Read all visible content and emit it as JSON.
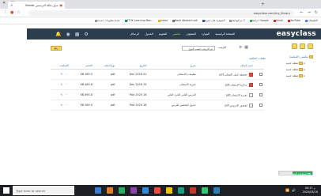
{
  "browser": {
    "tab_title": "سول ملکة الترسيس Seedle",
    "tab_close": "×",
    "new_tab": "+",
    "url": "easyclass.com/my_library",
    "bookmarks": [
      "التطبيقات",
      "YouTube",
      "Gmail",
      "خرائط Google",
      "مراجع لغة C",
      "الجوهرة على مدونة",
      "Book Abstract pdf",
      "index",
      "FTUK Learning Man...",
      "تغذية معلومات جديدة"
    ]
  },
  "site": {
    "logo": "easyclass",
    "nav": [
      "الصفحة الرئيسية",
      "الموارد",
      "الصفوف",
      "مكتبتي",
      "التقويم",
      "الجدول",
      "الرسائل"
    ],
    "nav_active_index": 3
  },
  "library": {
    "tree_root": "مكتبتي (المكتبة)",
    "folders": [
      "مجلد جديد",
      "مجلد جديد",
      "مجلد جديد"
    ],
    "new_button": "رفع",
    "sort_label": "الترتيب",
    "sort_value": "تم الترتيب حسب النوع",
    "subtitle": "ملفات المكتبة",
    "columns": [
      "اسم الملف",
      "شرح",
      "التاريخ",
      "نوع الملف",
      "الحجم",
      "العمليات"
    ],
    "rows": [
      {
        "name": "صحيفة عمل التصلب.pdf",
        "desc": "تعليمات الامتحان",
        "date": "Dec 2018 01",
        "type": "pdf",
        "size": "385.5 KB",
        "icon": "pdf"
      },
      {
        "name": "مذكرة الامتحان.pdf",
        "desc": "تجربة الامتحان",
        "date": "Dec 2018 29",
        "type": "pdf",
        "size": "480.8 KB",
        "icon": "pdf"
      },
      {
        "name": "تجربة الامتحان.pdf",
        "desc": "الدرس الثاني الجزء الثاني",
        "date": "Mar 2020 16",
        "type": "pdf",
        "size": "890.8 KB",
        "icon": "doc"
      },
      {
        "name": "لحضور الدروس.pdf",
        "desc": "جدول التحضير للدرس",
        "date": "Mar 2020 16",
        "type": "pdf",
        "size": "589.5 KB",
        "icon": "doc"
      }
    ],
    "row_actions": "⋯ ✎"
  },
  "storage": {
    "text": "استخدام المساحة 60.73 MB",
    "fraction": 0.6
  },
  "taskbar": {
    "search_placeholder": "Type here to search",
    "time": "04:17 م",
    "date": "2020/03/16",
    "icon_colors": [
      "#3a7bd5",
      "#e67e22",
      "#27ae60",
      "#8e44ad",
      "#2c8de0",
      "#e74c3c",
      "#f1c40f",
      "#16a085",
      "#c0392b",
      "#2ecc71",
      "#2980b9"
    ]
  }
}
